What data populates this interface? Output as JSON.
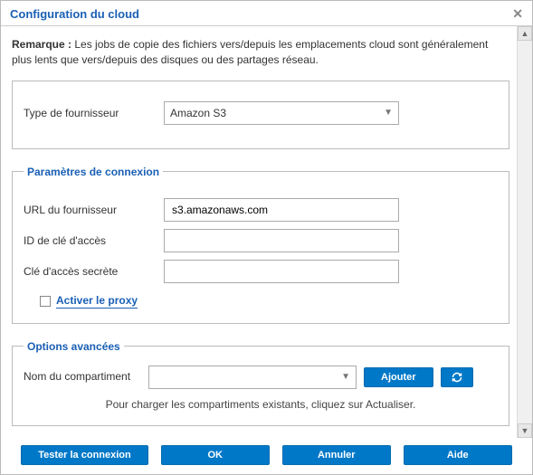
{
  "title": "Configuration du cloud",
  "remark_label": "Remarque :",
  "remark_text": "Les jobs de copie des fichiers vers/depuis les emplacements cloud sont généralement plus lents que vers/depuis des disques ou des partages réseau.",
  "vendor": {
    "label": "Type de fournisseur",
    "value": "Amazon S3"
  },
  "connection": {
    "legend": "Paramètres de connexion",
    "url_label": "URL du fournisseur",
    "url_value": "s3.amazonaws.com",
    "access_id_label": "ID de clé d'accès",
    "access_id_value": "",
    "secret_label": "Clé d'accès secrète",
    "secret_value": "",
    "proxy_label": "Activer le proxy"
  },
  "advanced": {
    "legend": "Options avancées",
    "bucket_label": "Nom du compartiment",
    "bucket_value": "",
    "add_label": "Ajouter",
    "hint": "Pour charger les compartiments existants, cliquez sur Actualiser."
  },
  "footer": {
    "test": "Tester la connexion",
    "ok": "OK",
    "cancel": "Annuler",
    "help": "Aide"
  }
}
